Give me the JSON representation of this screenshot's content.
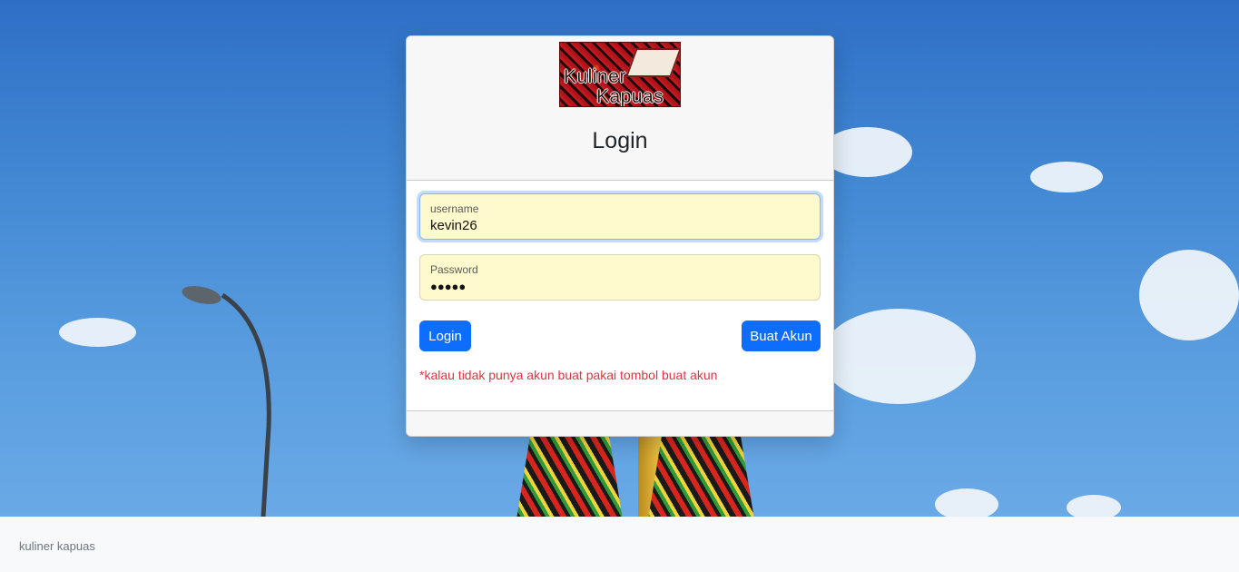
{
  "brand": {
    "logo_line1": "Kuliner",
    "logo_line2": "Kapuas"
  },
  "card": {
    "title": "Login"
  },
  "form": {
    "username_label": "username",
    "username_value": "kevin26",
    "password_label": "Password",
    "password_value": "●●●●●"
  },
  "buttons": {
    "login_label": "Login",
    "register_label": "Buat Akun"
  },
  "note": "*kalau tidak punya akun buat pakai tombol buat akun",
  "footer": {
    "text": "kuliner kapuas"
  },
  "colors": {
    "primary": "#0d6efd",
    "danger": "#dc3545",
    "autofill": "#fffacd"
  }
}
